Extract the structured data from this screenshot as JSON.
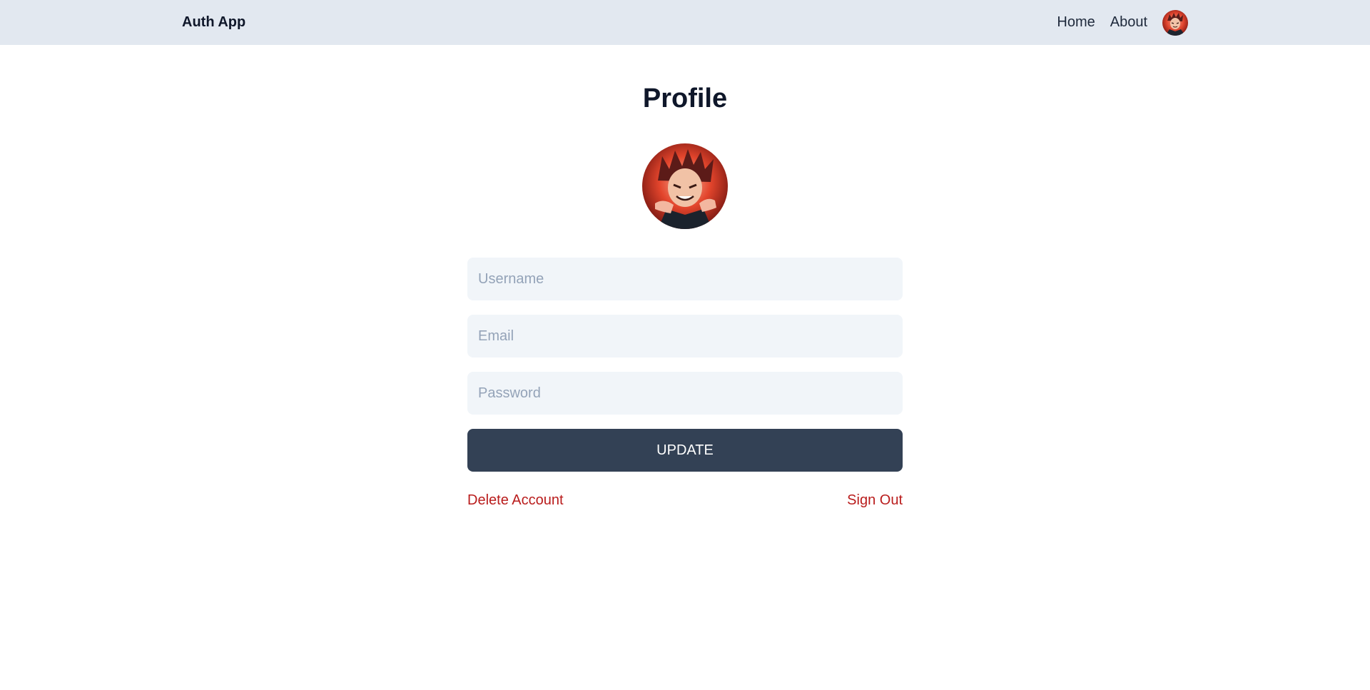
{
  "header": {
    "brand": "Auth App",
    "nav": {
      "home": "Home",
      "about": "About"
    },
    "avatar_icon": "user-avatar-icon"
  },
  "profile": {
    "title": "Profile",
    "avatar_icon": "profile-avatar-icon",
    "fields": {
      "username_placeholder": "Username",
      "email_placeholder": "Email",
      "password_placeholder": "Password"
    },
    "update_label": "UPDATE",
    "delete_label": "Delete Account",
    "signout_label": "Sign Out"
  },
  "colors": {
    "navbar_bg": "#e2e8f0",
    "input_bg": "#f1f5f9",
    "button_bg": "#334155",
    "danger": "#b91c1c"
  }
}
